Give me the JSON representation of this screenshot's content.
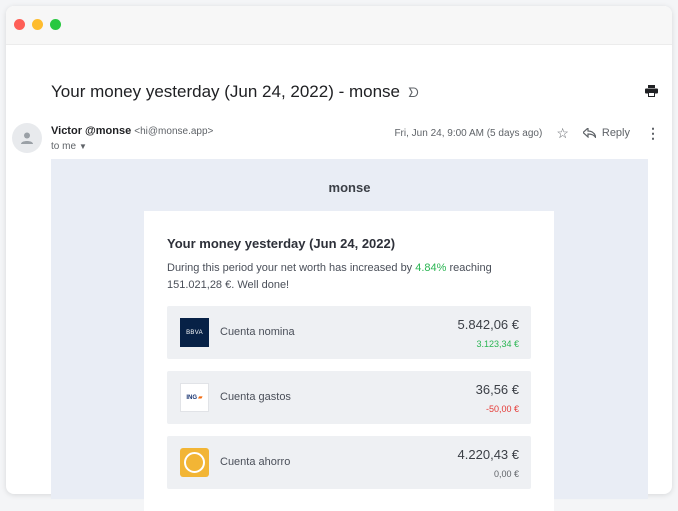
{
  "window": {
    "controls": [
      "close",
      "minimize",
      "maximize"
    ]
  },
  "message": {
    "subject": "Your money yesterday (Jun 24, 2022) - monse",
    "importance_icon": "label-important-icon",
    "sender_name": "Victor @monse",
    "sender_email": "<hi@monse.app>",
    "recipient": "to me",
    "date": "Fri, Jun 24, 9:00 AM (5 days ago)",
    "reply_label": "Reply"
  },
  "email": {
    "brand": "monse",
    "title": "Your money yesterday (Jun 24, 2022)",
    "summary_prefix": "During this period your net worth has increased by ",
    "summary_pct": "4.84%",
    "summary_suffix": " reaching 151.021,28 €. Well done!",
    "accounts": [
      {
        "logo": "BBVA",
        "name": "Cuenta nomina",
        "balance": "5.842,06 €",
        "change": "3.123,34 €",
        "trend": "positive"
      },
      {
        "logo": "ING",
        "name": "Cuenta gastos",
        "balance": "36,56 €",
        "change": "-50,00 €",
        "trend": "negative"
      },
      {
        "logo": "ahorro",
        "name": "Cuenta ahorro",
        "balance": "4.220,43 €",
        "change": "0,00 €",
        "trend": "neutral"
      }
    ]
  },
  "colors": {
    "positive": "#2bb553",
    "negative": "#e53935",
    "email_background": "#e9edf5"
  }
}
